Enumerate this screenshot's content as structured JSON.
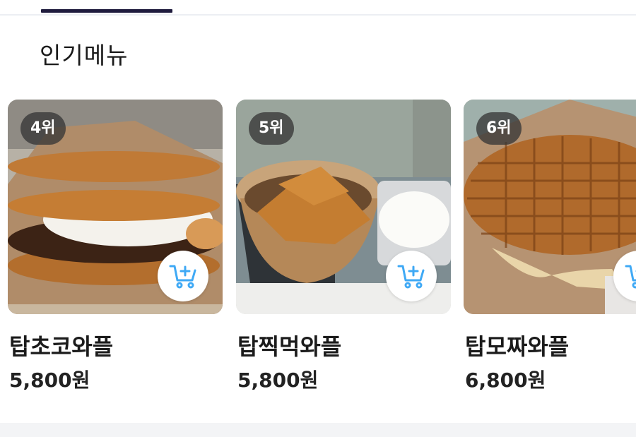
{
  "section_title": "인기메뉴",
  "cards": [
    {
      "rank": "4위",
      "name": "탑초코와플",
      "price": "5,800원"
    },
    {
      "rank": "5위",
      "name": "탑찍먹와플",
      "price": "5,800원"
    },
    {
      "rank": "6위",
      "name": "탑모짜와플",
      "price": "6,800원"
    }
  ],
  "colors": {
    "tab_indicator": "#1f1b3d",
    "cart_icon": "#3fa9f5",
    "rank_badge_bg": "#373737"
  }
}
